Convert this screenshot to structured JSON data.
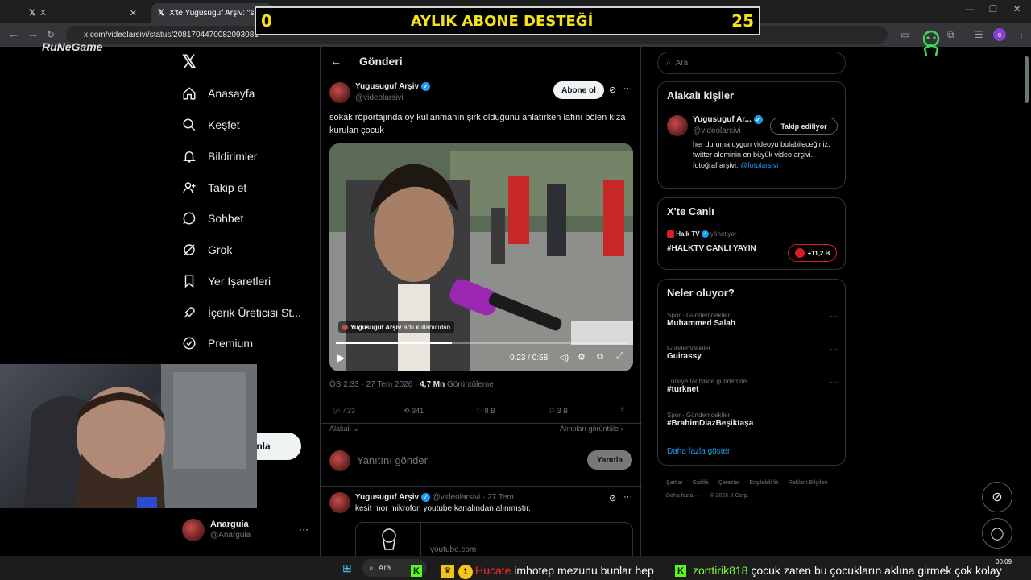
{
  "browser": {
    "tabs": [
      {
        "label": "X"
      },
      {
        "label": "X'te Yugusuguf Arşiv: \"sokak r"
      }
    ],
    "new_tab": "+",
    "url": "x.com/videolarsivi/status/2081704470082093081"
  },
  "overlay": {
    "left_count": "0",
    "title": "AYLIK ABONE DESTEĞİ",
    "right_count": "25",
    "brand": "RuNeGame"
  },
  "sidebar": {
    "items": [
      {
        "label": "Anasayfa",
        "icon": "home-icon"
      },
      {
        "label": "Keşfet",
        "icon": "search-icon"
      },
      {
        "label": "Bildirimler",
        "icon": "bell-icon"
      },
      {
        "label": "Takip et",
        "icon": "follow-icon"
      },
      {
        "label": "Sohbet",
        "icon": "chat-icon"
      },
      {
        "label": "Grok",
        "icon": "grok-icon"
      },
      {
        "label": "Yer İşaretleri",
        "icon": "bookmark-icon"
      },
      {
        "label": "İçerik Üreticisi St...",
        "icon": "rocket-icon"
      },
      {
        "label": "Premium",
        "icon": "premium-icon"
      }
    ],
    "post_button_partial": "nla",
    "account": {
      "name": "Anarguia",
      "handle": "@Anarguia"
    }
  },
  "header": {
    "title": "Gönderi"
  },
  "tweet": {
    "author": "Yugusuguf Arşiv",
    "handle": "@videolarsivi",
    "follow_label": "Abone ol",
    "text": "sokak röportajında oy kullanmanın şirk olduğunu anlatırken lafını bölen kıza kurulan çocuk",
    "video": {
      "attribution": "Yugusuguf Arşiv",
      "attribution_suffix": "adlı kullanıcıdan",
      "time": "0:23 / 0:58",
      "progress": 0.4
    },
    "timestamp": "ÖS 2:33 · 27 Tem 2026 ·",
    "views": "4,7 Mn",
    "views_label": "Görüntüleme",
    "stats": {
      "replies": "433",
      "reposts": "341",
      "likes": "8 B",
      "bookmarks": "3 B"
    },
    "relevance": "Alakalı",
    "quotes_link": "Alıntıları görüntüle"
  },
  "reply_box": {
    "placeholder": "Yanıtını gönder",
    "button": "Yanıtla"
  },
  "reply": {
    "author": "Yugusuguf Arşiv",
    "handle": "@videolarsivi",
    "date": "27 Tem",
    "text": "kesit mor mikrofon youtube kanalından alınmıştır.",
    "link_domain": "youtube.com"
  },
  "right": {
    "search_placeholder": "Ara",
    "related": {
      "title": "Alakalı kişiler",
      "name": "Yugusuguf Ar...",
      "handle": "@videolarsivi",
      "button": "Takip ediliyor",
      "bio": "her duruma uygun videoyu bulabileceğiniz, twitter aleminin en büyük video arşivi. fotoğraf arşivi:",
      "bio_link": "@fotolarsivi"
    },
    "live": {
      "title": "X'te Canlı",
      "channel": "Halk TV",
      "channel_role": "yönetiyor",
      "stream": "#HALKTV CANLI YAYIN",
      "listeners": "+11,2 B"
    },
    "trends": {
      "title": "Neler oluyor?",
      "items": [
        {
          "meta": "Spor · Gündemdekiler",
          "name": "Muhammed Salah"
        },
        {
          "meta": "Gündemdekiler",
          "name": "Guirassy"
        },
        {
          "meta": "Türkiye tarihinde gündemde",
          "name": "#turknet"
        },
        {
          "meta": "Spor · Gündemdekiler",
          "name": "#BrahimDiazBeşiktaşa"
        }
      ],
      "more": "Daha fazla göster"
    },
    "footer": [
      "Şartlar",
      "Gizlilik",
      "Çerezler",
      "Erişilebilirlik",
      "Reklam Bilgileri",
      "Daha fazla ···",
      "© 2026 X Corp."
    ]
  },
  "taskbar": {
    "search": "Ara",
    "clock": "00:09",
    "ticker": [
      {
        "user": "Hucate",
        "message": "imhotep mezunu bunlar hep",
        "color": "#ff2a2a"
      },
      {
        "user": "zorttirik818",
        "message": "çocuk zaten bu çocukların aklına girmek çok kolay",
        "color": "#7dff3a"
      }
    ],
    "badge": "1"
  }
}
